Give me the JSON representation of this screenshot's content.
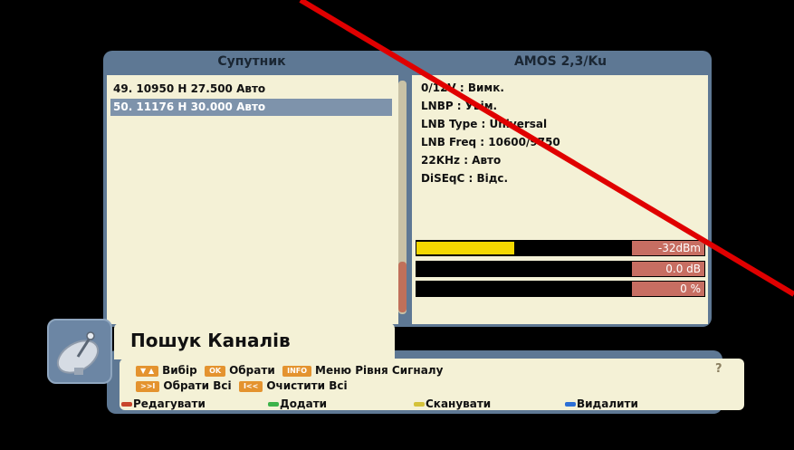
{
  "header": {
    "left_title": "Супутник",
    "right_title": "AMOS 2,3/Ku"
  },
  "transponders": [
    {
      "text": "49. 10950 H 27.500 Авто",
      "selected": false
    },
    {
      "text": "50. 11176 H 30.000 Авто",
      "selected": true
    }
  ],
  "info": [
    "0/12V : Вимк.",
    "LNBP : Увім.",
    "LNB Type : Universal",
    "LNB Freq : 10600/9750",
    "22KHz : Авто",
    "DiSEqC : Відс."
  ],
  "meters": [
    {
      "name": "signal-level",
      "fill": 0.46,
      "label": "-32dBm"
    },
    {
      "name": "signal-snr",
      "fill": 0,
      "label": "0.0  dB"
    },
    {
      "name": "signal-quality",
      "fill": 0,
      "label": "0  %"
    }
  ],
  "title": "Пошук Каналів",
  "hints": {
    "key_updown": "▼ ▲",
    "select": "Вибір",
    "key_ok": "OK",
    "choose": "Обрати",
    "key_info": "INFO",
    "signal_menu": "Меню Рівня Сигналу",
    "key_skip": ">>I",
    "choose_all": "Обрати Всі",
    "key_back": "I<<",
    "clear_all": "Очистити Всі"
  },
  "color_buttons": [
    {
      "label": "Редагувати",
      "color": "#c8452c"
    },
    {
      "label": "Додати",
      "color": "#3cb34a"
    },
    {
      "label": "Сканувати",
      "color": "#d4c23a"
    },
    {
      "label": "Видалити",
      "color": "#2c6fd6"
    }
  ],
  "help_icon": "?",
  "overlay_color": "#e00000"
}
